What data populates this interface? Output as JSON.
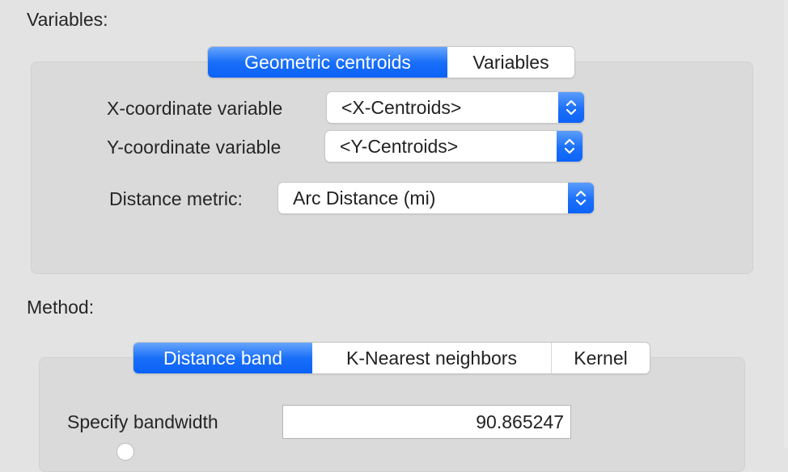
{
  "variables_section": {
    "label": "Variables:",
    "tabs": [
      {
        "label": "Geometric centroids",
        "active": true
      },
      {
        "label": "Variables",
        "active": false
      }
    ],
    "x_coordinate": {
      "label": "X-coordinate variable",
      "value": "<X-Centroids>"
    },
    "y_coordinate": {
      "label": "Y-coordinate variable",
      "value": "<Y-Centroids>"
    },
    "distance_metric": {
      "label": "Distance metric:",
      "value": "Arc Distance (mi)"
    }
  },
  "method_section": {
    "label": "Method:",
    "tabs": [
      {
        "label": "Distance band",
        "active": true
      },
      {
        "label": "K-Nearest neighbors",
        "active": false
      },
      {
        "label": "Kernel",
        "active": false
      }
    ],
    "bandwidth": {
      "label": "Specify bandwidth",
      "value": "90.865247"
    }
  },
  "colors": {
    "accent": "#1a6ff8",
    "background": "#e3e3e3",
    "groupbox": "#dadada"
  },
  "icons": {
    "popup_stepper": "chevron-up-down-icon"
  }
}
